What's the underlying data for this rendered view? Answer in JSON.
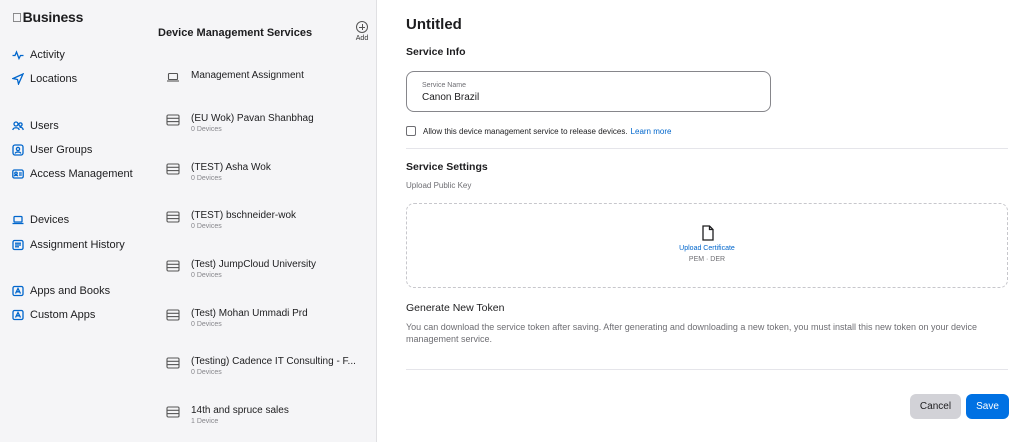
{
  "sidebar": {
    "brand_glyph": "",
    "brand": "Business",
    "items": [
      {
        "label": "Activity",
        "icon": "activity-icon"
      },
      {
        "label": "Locations",
        "icon": "location-arrow-icon"
      },
      {
        "label": "Users",
        "icon": "users-icon"
      },
      {
        "label": "User Groups",
        "icon": "user-groups-icon"
      },
      {
        "label": "Access Management",
        "icon": "id-card-icon"
      },
      {
        "label": "Devices",
        "icon": "laptop-icon"
      },
      {
        "label": "Assignment History",
        "icon": "history-list-icon"
      },
      {
        "label": "Apps and Books",
        "icon": "apps-icon"
      },
      {
        "label": "Custom Apps",
        "icon": "custom-apps-icon"
      }
    ]
  },
  "list": {
    "title": "Device Management Services",
    "add_label": "Add",
    "items": [
      {
        "name": "Management Assignment",
        "sub": "",
        "icon": "laptop-icon"
      },
      {
        "name": "(EU Wok) Pavan Shanbhag",
        "sub": "0 Devices",
        "icon": "server-icon"
      },
      {
        "name": "(TEST) Asha Wok",
        "sub": "0 Devices",
        "icon": "server-icon"
      },
      {
        "name": "(TEST) bschneider-wok",
        "sub": "0 Devices",
        "icon": "server-icon"
      },
      {
        "name": "(Test) JumpCloud University",
        "sub": "0 Devices",
        "icon": "server-icon"
      },
      {
        "name": "(Test) Mohan Ummadi Prd",
        "sub": "0 Devices",
        "icon": "server-icon"
      },
      {
        "name": "(Testing) Cadence IT Consulting - F...",
        "sub": "0 Devices",
        "icon": "server-icon"
      },
      {
        "name": "14th and spruce sales",
        "sub": "1 Device",
        "icon": "server-icon"
      }
    ]
  },
  "main": {
    "title": "Untitled",
    "service_info": "Service Info",
    "service_name_label": "Service Name",
    "service_name_value": "Canon Brazil",
    "allow_text": "Allow this device management service to release devices.",
    "learn_more": "Learn more",
    "service_settings": "Service Settings",
    "upload_public_key": "Upload Public Key",
    "upload_certificate": "Upload Certificate",
    "formats": "PEM · DER",
    "generate_title": "Generate New Token",
    "generate_desc": "You can download the service token after saving. After generating and downloading a new token, you must install this new token on your device management service.",
    "cancel": "Cancel",
    "save": "Save"
  },
  "colors": {
    "accent": "#0071e3",
    "link": "#0066cc",
    "sidebar_bg": "#f5f5f7"
  }
}
